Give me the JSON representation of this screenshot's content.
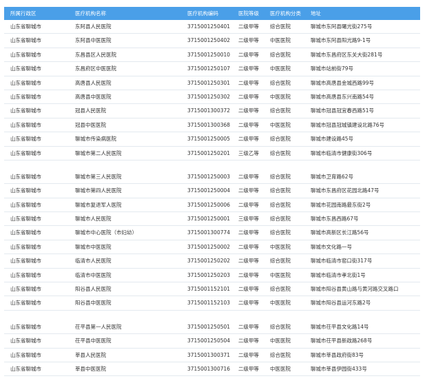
{
  "table": {
    "columns": [
      "所属行政区",
      "医疗机构名称",
      "医疗机构编码",
      "医院等级",
      "医疗机构分类",
      "地址"
    ],
    "groups": [
      [
        [
          "山东省聊城市",
          "东阿县人民医院",
          "3715001250401",
          "二级甲等",
          "综合医院",
          "聊城市东阿县曙光街275号"
        ],
        [
          "山东省聊城市",
          "东阿县中医医院",
          "3715001250402",
          "二级甲等",
          "中医医院",
          "聊城市东阿县阳光路9-1号"
        ],
        [
          "山东省聊城市",
          "东昌县区人民医院",
          "3715001250010",
          "二级甲等",
          "综合医院",
          "聊城市东昌府区东关大街281号"
        ],
        [
          "山东省聊城市",
          "东昌府区中医医院",
          "3715001250107",
          "二级甲等",
          "中医医院",
          "聊城市站前街79号"
        ],
        [
          "山东省聊城市",
          "高唐县人民医院",
          "3715001250301",
          "二级甲等",
          "综合医院",
          "聊城市高唐县金城西路99号"
        ],
        [
          "山东省聊城市",
          "高唐县中医医院",
          "3715001250302",
          "二级甲等",
          "中医医院",
          "聊城市高唐县东兴南路54号"
        ],
        [
          "山东省聊城市",
          "冠县人民医院",
          "3715001300372",
          "二级甲等",
          "综合医院",
          "聊城市冠县冠宜春西路51号"
        ],
        [
          "山东省聊城市",
          "冠县中医医院",
          "3715001300368",
          "二级甲等",
          "中医医院",
          "聊城市冠县冠城镇建设北路76号"
        ],
        [
          "山东省聊城市",
          "聊城市传染病医院",
          "3715001250005",
          "二级甲等",
          "综合医院",
          "聊城市建设路45号"
        ],
        [
          "山东省聊城市",
          "聊城市第二人民医院",
          "3715001250201",
          "三级乙等",
          "综合医院",
          "聊城市临清市健康街306号"
        ]
      ],
      [
        [
          "山东省聊城市",
          "聊城市第三人民医院",
          "3715001250003",
          "二级甲等",
          "综合医院",
          "聊城市卫育路62号"
        ],
        [
          "山东省聊城市",
          "聊城市第四人民医院",
          "3715001250004",
          "二级甲等",
          "综合医院",
          "聊城市东昌府区花园北路47号"
        ],
        [
          "山东省聊城市",
          "聊城市复退军人医院",
          "3715001250006",
          "二级甲等",
          "综合医院",
          "聊城市花园南路最东街2号"
        ],
        [
          "山东省聊城市",
          "聊城市人民医院",
          "3715001250001",
          "三级甲等",
          "综合医院",
          "聊城市东昌西路67号"
        ],
        [
          "山东省聊城市",
          "聊城市中心医院（市妇幼）",
          "3715001300774",
          "二级甲等",
          "综合医院",
          "聊城市高新区长江路56号"
        ],
        [
          "山东省聊城市",
          "聊城市中医医院",
          "3715001250002",
          "二级甲等",
          "中医医院",
          "聊城市文化路一号"
        ],
        [
          "山东省聊城市",
          "临清市人民医院",
          "3715001250202",
          "二级甲等",
          "综合医院",
          "聊城市临清市窑口街317号"
        ],
        [
          "山东省聊城市",
          "临清市中医医院",
          "3715001250203",
          "二级甲等",
          "中医医院",
          "聊城市临清市孝北街1号"
        ],
        [
          "山东省聊城市",
          "阳谷县人民医院",
          "3715001152101",
          "二级甲等",
          "综合医院",
          "聊城市阳谷县黄山路与黄河路交叉路口"
        ],
        [
          "山东省聊城市",
          "阳谷县中医医院",
          "3715001152103",
          "二级甲等",
          "中医医院",
          "聊城市阳谷县运河东路2号"
        ]
      ],
      [
        [
          "山东省聊城市",
          "茌平县第一人民医院",
          "3715001250501",
          "二级甲等",
          "综合医院",
          "聊城市茌平县文化路14号"
        ],
        [
          "山东省聊城市",
          "茌平县中医医院",
          "3715001250504",
          "二级甲等",
          "中医医院",
          "聊城市茌平县新政路268号"
        ],
        [
          "山东省聊城市",
          "莘县人民医院",
          "3715001300371",
          "二级甲等",
          "综合医院",
          "聊城市莘县政府街83号"
        ],
        [
          "山东省聊城市",
          "莘县中医医院",
          "3715001300716",
          "二级甲等",
          "中医医院",
          "聊城市莘县伊园街433号"
        ]
      ]
    ]
  }
}
